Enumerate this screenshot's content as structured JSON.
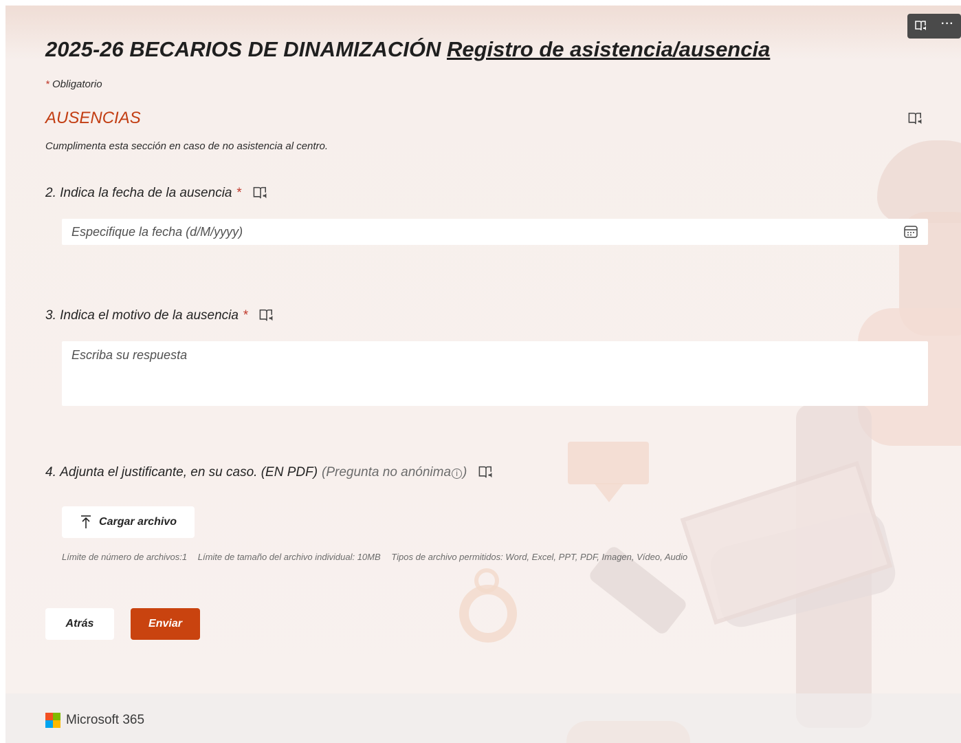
{
  "toolbar": {
    "reader_icon": "immersive-reader-icon",
    "more_icon": "more-options-icon",
    "more_label": "···"
  },
  "form": {
    "title_main": "2025-26 BECARIOS DE DINAMIZACIÓN",
    "title_link": "Registro de asistencia/ausencia",
    "required_star": "*",
    "required_label": "Obligatorio"
  },
  "section": {
    "title": "AUSENCIAS",
    "description": "Cumplimenta esta sección en caso de no asistencia al centro."
  },
  "questions": [
    {
      "number": "2.",
      "label": "Indica la fecha de la ausencia",
      "required": "*",
      "placeholder": "Especifique la fecha (d/M/yyyy)"
    },
    {
      "number": "3.",
      "label": "Indica el motivo de la ausencia",
      "required": "*",
      "placeholder": "Escriba su respuesta"
    },
    {
      "number": "4.",
      "label": "Adjunta el justificante, en su caso. (EN PDF)",
      "note_open": "(Pregunta no anónima",
      "note_info": "i",
      "note_close": ")",
      "upload_label": "Cargar archivo",
      "limits": [
        "Límite de número de archivos:1",
        "Límite de tamaño del archivo individual: 10MB",
        "Tipos de archivo permitidos: Word, Excel, PPT, PDF, Imagen, Vídeo, Audio"
      ]
    }
  ],
  "actions": {
    "back_label": "Atrás",
    "submit_label": "Enviar"
  },
  "footer": {
    "brand": "Microsoft 365"
  },
  "colors": {
    "accent": "#c9430f",
    "section_title": "#c23d12",
    "required": "#c0392b",
    "ms_red": "#f25022",
    "ms_green": "#7fba00",
    "ms_blue": "#00a4ef",
    "ms_yellow": "#ffb900"
  }
}
